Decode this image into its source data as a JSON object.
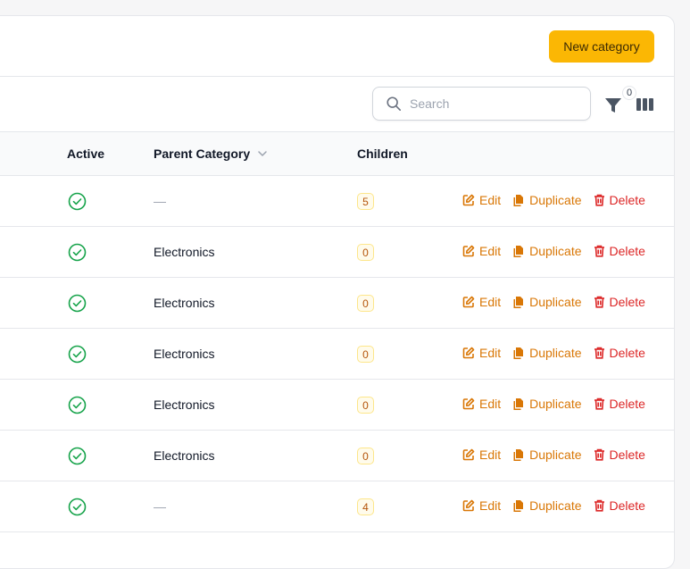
{
  "header": {
    "new_button_label": "New category"
  },
  "toolbar": {
    "search_placeholder": "Search",
    "filter_count": "0"
  },
  "table": {
    "columns": {
      "active": "Active",
      "parent_category": "Parent Category",
      "children": "Children"
    },
    "actions": {
      "edit": "Edit",
      "duplicate": "Duplicate",
      "delete": "Delete"
    },
    "rows": [
      {
        "active": true,
        "parent_category": "—",
        "children": "5"
      },
      {
        "active": true,
        "parent_category": "Electronics",
        "children": "0"
      },
      {
        "active": true,
        "parent_category": "Electronics",
        "children": "0"
      },
      {
        "active": true,
        "parent_category": "Electronics",
        "children": "0"
      },
      {
        "active": true,
        "parent_category": "Electronics",
        "children": "0"
      },
      {
        "active": true,
        "parent_category": "Electronics",
        "children": "0"
      },
      {
        "active": true,
        "parent_category": "—",
        "children": "4"
      }
    ]
  },
  "colors": {
    "primary": "#fbb704",
    "active_icon": "#16a34a",
    "edit": "#d97706",
    "delete": "#dc2626"
  },
  "icons": {
    "search": "search-icon",
    "filter": "filter-icon",
    "columns": "columns-icon",
    "sort": "chevron-down-icon",
    "active": "check-circle-icon",
    "edit": "edit-icon",
    "duplicate": "duplicate-icon",
    "delete": "trash-icon"
  }
}
